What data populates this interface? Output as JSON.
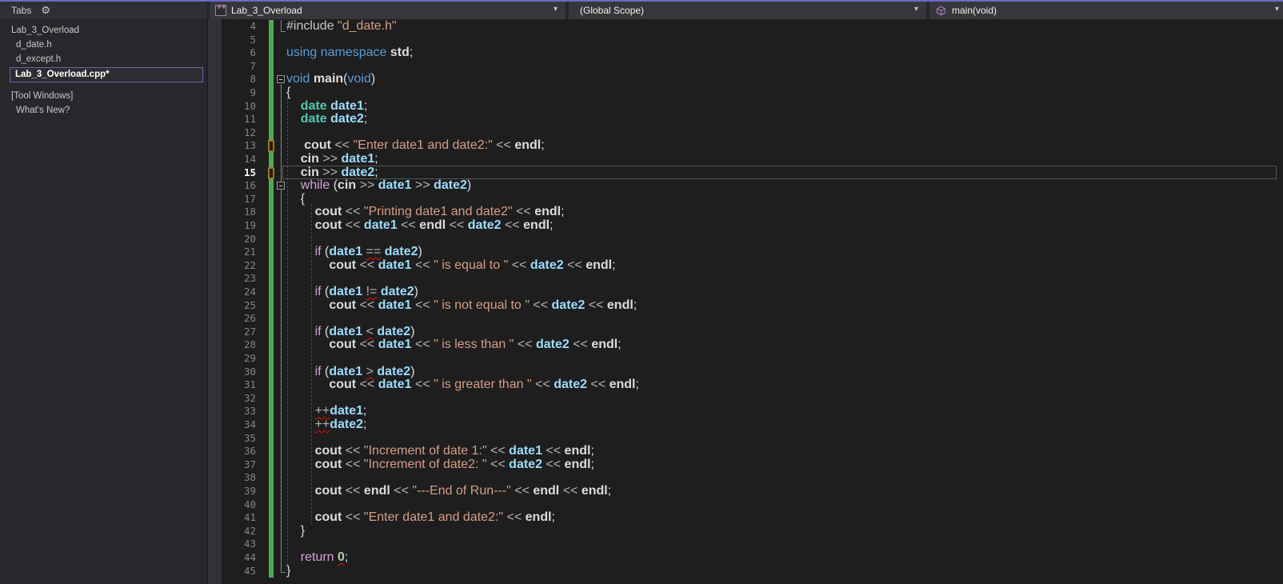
{
  "nav": {
    "document": {
      "label": "Lab_3_Overload",
      "icon": "cpp-file-icon"
    },
    "scope": {
      "label": "(Global Scope)"
    },
    "member": {
      "label": "main(void)",
      "icon": "method-cube-icon"
    }
  },
  "sidebar": {
    "header": {
      "title": "Tabs",
      "gear_icon": "⚙"
    },
    "items": [
      {
        "label": "Lab_3_Overload",
        "indent": 0,
        "selected": false,
        "gap": false
      },
      {
        "label": "d_date.h",
        "indent": 1,
        "selected": false,
        "gap": false
      },
      {
        "label": "d_except.h",
        "indent": 1,
        "selected": false,
        "gap": false
      },
      {
        "label": "Lab_3_Overload.cpp*",
        "indent": 1,
        "selected": true,
        "gap": false
      },
      {
        "label": "[Tool Windows]",
        "indent": 0,
        "selected": false,
        "gap": true
      },
      {
        "label": "What's New?",
        "indent": 1,
        "selected": false,
        "gap": false
      }
    ]
  },
  "colors": {
    "accent_top": "#6c69c9",
    "selection_border": "#6163ac",
    "track_change_saved": "#53a857",
    "track_change_unsaved_mark": "#96781e",
    "error_squiggle": "#e51400",
    "keyword": "#569cd6",
    "control_keyword": "#d8a0df",
    "type_name": "#4ec9b0",
    "local_variable": "#9cdcfe",
    "identifier": "#dcdcdc",
    "operator": "#b4b4b4",
    "string": "#d69d85",
    "number": "#b5cea8",
    "preprocessor": "#c8c8c8",
    "line_number": "#848484",
    "editor_bg": "#1e1e1e"
  },
  "editor": {
    "first_line": 4,
    "current_line": 15,
    "lines": [
      {
        "n": 4,
        "region_end": true,
        "seg": [
          [
            "pre",
            "#include "
          ],
          [
            "str",
            "\"d_date.h\""
          ]
        ]
      },
      {
        "n": 5,
        "seg": []
      },
      {
        "n": 6,
        "seg": [
          [
            "kw",
            "using"
          ],
          [
            "pl",
            " "
          ],
          [
            "kw",
            "namespace"
          ],
          [
            "pl",
            " "
          ],
          [
            "id",
            "std"
          ],
          [
            "pl",
            ";"
          ]
        ]
      },
      {
        "n": 7,
        "seg": []
      },
      {
        "n": 8,
        "fold": true,
        "seg": [
          [
            "kw",
            "void"
          ],
          [
            "pl",
            " "
          ],
          [
            "fn",
            "main"
          ],
          [
            "pl",
            "("
          ],
          [
            "kw",
            "void"
          ],
          [
            "pl",
            ")"
          ]
        ]
      },
      {
        "n": 9,
        "seg": [
          [
            "pl",
            "{"
          ]
        ]
      },
      {
        "n": 10,
        "seg": [
          [
            "pl",
            "    "
          ],
          [
            "type",
            "date"
          ],
          [
            "pl",
            " "
          ],
          [
            "var",
            "date1"
          ],
          [
            "pl",
            ";"
          ]
        ]
      },
      {
        "n": 11,
        "seg": [
          [
            "pl",
            "    "
          ],
          [
            "type",
            "date"
          ],
          [
            "pl",
            " "
          ],
          [
            "var",
            "date2"
          ],
          [
            "pl",
            ";"
          ]
        ]
      },
      {
        "n": 12,
        "seg": []
      },
      {
        "n": 13,
        "mark": true,
        "seg": [
          [
            "pl",
            "     "
          ],
          [
            "id",
            "cout"
          ],
          [
            "op",
            " << "
          ],
          [
            "str",
            "\"Enter date1 and date2:\""
          ],
          [
            "op",
            " << "
          ],
          [
            "id",
            "endl"
          ],
          [
            "pl",
            ";"
          ]
        ]
      },
      {
        "n": 14,
        "seg": [
          [
            "pl",
            "    "
          ],
          [
            "id",
            "cin"
          ],
          [
            "op",
            " >> "
          ],
          [
            "var",
            "date1"
          ],
          [
            "pl",
            ";"
          ]
        ]
      },
      {
        "n": 15,
        "mark": true,
        "current": true,
        "seg": [
          [
            "pl",
            "    "
          ],
          [
            "id",
            "cin"
          ],
          [
            "op",
            " >> "
          ],
          [
            "var",
            "date2"
          ],
          [
            "pl",
            ";"
          ]
        ]
      },
      {
        "n": 16,
        "fold": true,
        "seg": [
          [
            "pl",
            "    "
          ],
          [
            "ctrl",
            "while"
          ],
          [
            "pl",
            " ("
          ],
          [
            "id",
            "cin"
          ],
          [
            "op",
            " >> "
          ],
          [
            "var",
            "date1"
          ],
          [
            "op",
            " >> "
          ],
          [
            "var",
            "date2"
          ],
          [
            "pl",
            ")"
          ]
        ]
      },
      {
        "n": 17,
        "seg": [
          [
            "pl",
            "    {"
          ]
        ]
      },
      {
        "n": 18,
        "seg": [
          [
            "pl",
            "        "
          ],
          [
            "id",
            "cout"
          ],
          [
            "op",
            " << "
          ],
          [
            "str",
            "\"Printing date1 and date2\""
          ],
          [
            "op",
            " << "
          ],
          [
            "id",
            "endl"
          ],
          [
            "pl",
            ";"
          ]
        ]
      },
      {
        "n": 19,
        "seg": [
          [
            "pl",
            "        "
          ],
          [
            "id",
            "cout"
          ],
          [
            "op",
            " << "
          ],
          [
            "var",
            "date1"
          ],
          [
            "op",
            " << "
          ],
          [
            "id",
            "endl"
          ],
          [
            "op",
            " << "
          ],
          [
            "var",
            "date2"
          ],
          [
            "op",
            " << "
          ],
          [
            "id",
            "endl"
          ],
          [
            "pl",
            ";"
          ]
        ]
      },
      {
        "n": 20,
        "seg": []
      },
      {
        "n": 21,
        "seg": [
          [
            "pl",
            "        "
          ],
          [
            "ctrl",
            "if"
          ],
          [
            "pl",
            " ("
          ],
          [
            "var",
            "date1"
          ],
          [
            "pl",
            " "
          ],
          [
            "opsq",
            "=="
          ],
          [
            "pl",
            " "
          ],
          [
            "var",
            "date2"
          ],
          [
            "pl",
            ")"
          ]
        ]
      },
      {
        "n": 22,
        "seg": [
          [
            "pl",
            "            "
          ],
          [
            "id",
            "cout"
          ],
          [
            "op",
            " << "
          ],
          [
            "var",
            "date1"
          ],
          [
            "op",
            " << "
          ],
          [
            "str",
            "\" is equal to \""
          ],
          [
            "op",
            " << "
          ],
          [
            "var",
            "date2"
          ],
          [
            "op",
            " << "
          ],
          [
            "id",
            "endl"
          ],
          [
            "pl",
            ";"
          ]
        ]
      },
      {
        "n": 23,
        "seg": []
      },
      {
        "n": 24,
        "seg": [
          [
            "pl",
            "        "
          ],
          [
            "ctrl",
            "if"
          ],
          [
            "pl",
            " ("
          ],
          [
            "var",
            "date1"
          ],
          [
            "pl",
            " "
          ],
          [
            "opsq",
            "!="
          ],
          [
            "pl",
            " "
          ],
          [
            "var",
            "date2"
          ],
          [
            "pl",
            ")"
          ]
        ]
      },
      {
        "n": 25,
        "seg": [
          [
            "pl",
            "            "
          ],
          [
            "id",
            "cout"
          ],
          [
            "op",
            " << "
          ],
          [
            "var",
            "date1"
          ],
          [
            "op",
            " << "
          ],
          [
            "str",
            "\" is not equal to \""
          ],
          [
            "op",
            " << "
          ],
          [
            "var",
            "date2"
          ],
          [
            "op",
            " << "
          ],
          [
            "id",
            "endl"
          ],
          [
            "pl",
            ";"
          ]
        ]
      },
      {
        "n": 26,
        "seg": []
      },
      {
        "n": 27,
        "seg": [
          [
            "pl",
            "        "
          ],
          [
            "ctrl",
            "if"
          ],
          [
            "pl",
            " ("
          ],
          [
            "var",
            "date1"
          ],
          [
            "pl",
            " "
          ],
          [
            "opsq",
            "<"
          ],
          [
            "pl",
            " "
          ],
          [
            "var",
            "date2"
          ],
          [
            "pl",
            ")"
          ]
        ]
      },
      {
        "n": 28,
        "seg": [
          [
            "pl",
            "            "
          ],
          [
            "id",
            "cout"
          ],
          [
            "op",
            " << "
          ],
          [
            "var",
            "date1"
          ],
          [
            "op",
            " << "
          ],
          [
            "str",
            "\" is less than \""
          ],
          [
            "op",
            " << "
          ],
          [
            "var",
            "date2"
          ],
          [
            "op",
            " << "
          ],
          [
            "id",
            "endl"
          ],
          [
            "pl",
            ";"
          ]
        ]
      },
      {
        "n": 29,
        "seg": []
      },
      {
        "n": 30,
        "seg": [
          [
            "pl",
            "        "
          ],
          [
            "ctrl",
            "if"
          ],
          [
            "pl",
            " ("
          ],
          [
            "var",
            "date1"
          ],
          [
            "pl",
            " "
          ],
          [
            "opsq",
            ">"
          ],
          [
            "pl",
            " "
          ],
          [
            "var",
            "date2"
          ],
          [
            "pl",
            ")"
          ]
        ]
      },
      {
        "n": 31,
        "seg": [
          [
            "pl",
            "            "
          ],
          [
            "id",
            "cout"
          ],
          [
            "op",
            " << "
          ],
          [
            "var",
            "date1"
          ],
          [
            "op",
            " << "
          ],
          [
            "str",
            "\" is greater than \""
          ],
          [
            "op",
            " << "
          ],
          [
            "var",
            "date2"
          ],
          [
            "op",
            " << "
          ],
          [
            "id",
            "endl"
          ],
          [
            "pl",
            ";"
          ]
        ]
      },
      {
        "n": 32,
        "seg": []
      },
      {
        "n": 33,
        "seg": [
          [
            "pl",
            "        "
          ],
          [
            "opsq",
            "++"
          ],
          [
            "var",
            "date1"
          ],
          [
            "pl",
            ";"
          ]
        ]
      },
      {
        "n": 34,
        "seg": [
          [
            "pl",
            "        "
          ],
          [
            "opsq",
            "++"
          ],
          [
            "var",
            "date2"
          ],
          [
            "pl",
            ";"
          ]
        ]
      },
      {
        "n": 35,
        "seg": []
      },
      {
        "n": 36,
        "seg": [
          [
            "pl",
            "        "
          ],
          [
            "id",
            "cout"
          ],
          [
            "op",
            " << "
          ],
          [
            "str",
            "\"Increment of date 1:\""
          ],
          [
            "op",
            " << "
          ],
          [
            "var",
            "date1"
          ],
          [
            "op",
            " << "
          ],
          [
            "id",
            "endl"
          ],
          [
            "pl",
            ";"
          ]
        ]
      },
      {
        "n": 37,
        "seg": [
          [
            "pl",
            "        "
          ],
          [
            "id",
            "cout"
          ],
          [
            "op",
            " << "
          ],
          [
            "str",
            "\"Increment of date2: \""
          ],
          [
            "op",
            " << "
          ],
          [
            "var",
            "date2"
          ],
          [
            "op",
            " << "
          ],
          [
            "id",
            "endl"
          ],
          [
            "pl",
            ";"
          ]
        ]
      },
      {
        "n": 38,
        "seg": []
      },
      {
        "n": 39,
        "seg": [
          [
            "pl",
            "        "
          ],
          [
            "id",
            "cout"
          ],
          [
            "op",
            " << "
          ],
          [
            "id",
            "endl"
          ],
          [
            "op",
            " << "
          ],
          [
            "str",
            "\"---End of Run---\""
          ],
          [
            "op",
            " << "
          ],
          [
            "id",
            "endl"
          ],
          [
            "op",
            " << "
          ],
          [
            "id",
            "endl"
          ],
          [
            "pl",
            ";"
          ]
        ]
      },
      {
        "n": 40,
        "seg": []
      },
      {
        "n": 41,
        "seg": [
          [
            "pl",
            "        "
          ],
          [
            "id",
            "cout"
          ],
          [
            "op",
            " << "
          ],
          [
            "str",
            "\"Enter date1 and date2:\""
          ],
          [
            "op",
            " << "
          ],
          [
            "id",
            "endl"
          ],
          [
            "pl",
            ";"
          ]
        ]
      },
      {
        "n": 42,
        "seg": [
          [
            "pl",
            "    }"
          ]
        ]
      },
      {
        "n": 43,
        "seg": []
      },
      {
        "n": 44,
        "seg": [
          [
            "pl",
            "    "
          ],
          [
            "ctrl",
            "return"
          ],
          [
            "pl",
            " "
          ],
          [
            "numsq",
            "0"
          ],
          [
            "pl",
            ";"
          ]
        ]
      },
      {
        "n": 45,
        "seg": [
          [
            "pl",
            "}"
          ]
        ]
      }
    ]
  }
}
